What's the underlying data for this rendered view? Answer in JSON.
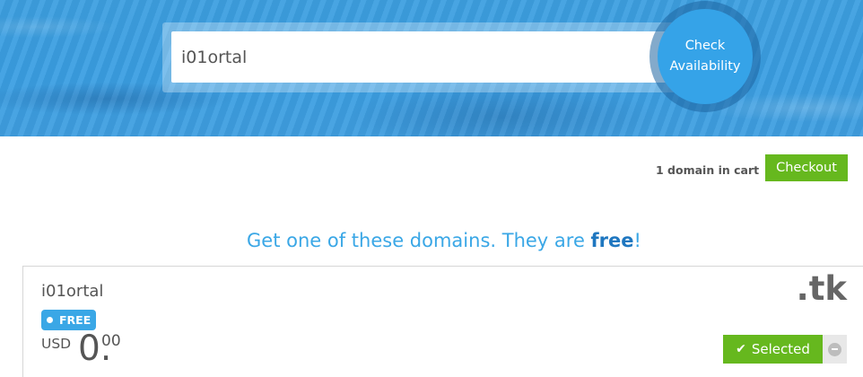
{
  "search": {
    "value": "i01ortal",
    "check_label_line1": "Check",
    "check_label_line2": "Availability"
  },
  "cart": {
    "summary": "1 domain in cart",
    "checkout_label": "Checkout"
  },
  "headline": {
    "text_before": "Get one of these domains. They are ",
    "emphasis": "free",
    "text_after": "!"
  },
  "result": {
    "domain_name": "i01ortal",
    "tld": ".tk",
    "badge": "FREE",
    "currency": "USD",
    "price_integer": "0.",
    "price_cents": "00",
    "selected_label": "Selected",
    "selected_icon": "check-icon",
    "remove_icon": "minus-circle-icon"
  },
  "colors": {
    "brand_blue": "#3aa7e6",
    "accent_green": "#66b81e"
  }
}
